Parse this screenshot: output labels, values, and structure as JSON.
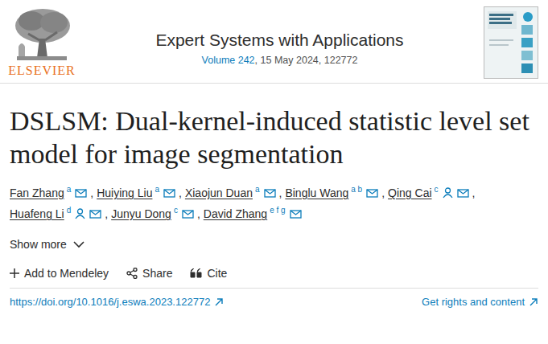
{
  "publisher": {
    "logo_text": "ELSEVIER"
  },
  "journal": {
    "name": "Expert Systems with Applications",
    "volume_link": "Volume 242",
    "details": ", 15 May 2024, 122772"
  },
  "title": "DSLSM: Dual-kernel-induced statistic level set model for image segmentation",
  "authors": [
    {
      "name": "Fan Zhang",
      "affiliations": "a",
      "corresponding": false,
      "separator": ","
    },
    {
      "name": "Huiying Liu",
      "affiliations": "a",
      "corresponding": false,
      "separator": ","
    },
    {
      "name": "Xiaojun Duan",
      "affiliations": "a",
      "corresponding": false,
      "separator": ","
    },
    {
      "name": "Binglu Wang",
      "affiliations": "a b",
      "corresponding": false,
      "separator": ","
    },
    {
      "name": "Qing Cai",
      "affiliations": "c",
      "corresponding": true,
      "separator": ","
    },
    {
      "name": "Huafeng Li",
      "affiliations": "d",
      "corresponding": true,
      "separator": ","
    },
    {
      "name": "Junyu Dong",
      "affiliations": "c",
      "corresponding": false,
      "separator": ","
    },
    {
      "name": "David Zhang",
      "affiliations": "e f g",
      "corresponding": false,
      "separator": ""
    }
  ],
  "show_more": "Show more",
  "actions": [
    {
      "label": "Add to Mendeley",
      "kind": "add"
    },
    {
      "label": "Share",
      "kind": "share"
    },
    {
      "label": "Cite",
      "kind": "cite"
    }
  ],
  "doi": "https://doi.org/10.1016/j.eswa.2023.122772",
  "rights": "Get rights and content"
}
